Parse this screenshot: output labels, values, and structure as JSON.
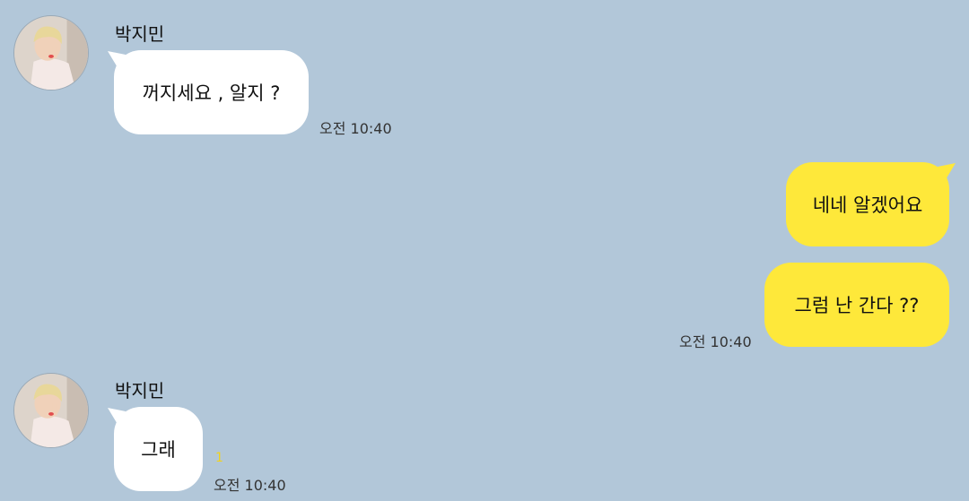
{
  "messages": [
    {
      "sender": "박지민",
      "text": "꺼지세요 , 알지 ?",
      "time": "오전 10:40"
    },
    {
      "text": "네네 알겠어요"
    },
    {
      "text": "그럼 난 간다 ??",
      "time": "오전 10:40"
    },
    {
      "sender": "박지민",
      "text": "그래",
      "time": "오전 10:40",
      "unread": "1"
    }
  ],
  "colors": {
    "background": "#b2c7d9",
    "incoming_bubble": "#ffffff",
    "outgoing_bubble": "#fee83a",
    "unread": "#f2d31b"
  }
}
